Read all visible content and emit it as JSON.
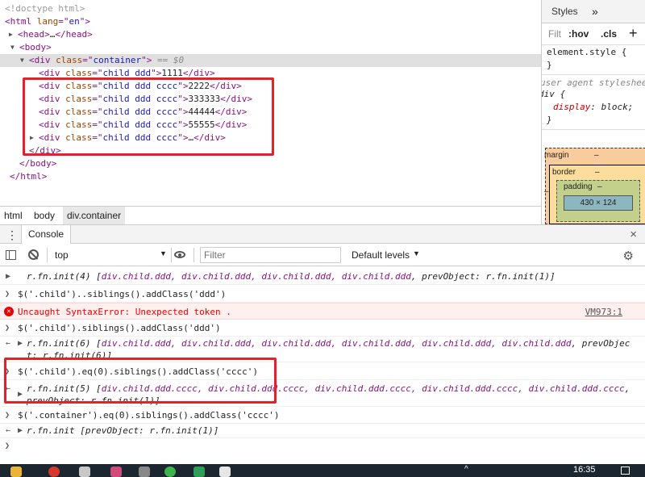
{
  "elements": {
    "lines": [
      {
        "indent": 0,
        "parts": [
          {
            "c": "comment",
            "t": "<!doctype html>"
          }
        ]
      },
      {
        "indent": 0,
        "parts": [
          {
            "c": "tag",
            "t": "<html "
          },
          {
            "c": "attr",
            "t": "lang"
          },
          {
            "c": "tag",
            "t": "=\""
          },
          {
            "c": "aval",
            "t": "en"
          },
          {
            "c": "tag",
            "t": "\">"
          }
        ]
      },
      {
        "indent": 1,
        "tri": "▶",
        "parts": [
          {
            "c": "tag",
            "t": "<head>"
          },
          {
            "c": "txt",
            "t": "…"
          },
          {
            "c": "tag",
            "t": "</head>"
          }
        ]
      },
      {
        "indent": 1,
        "tri": "▼",
        "parts": [
          {
            "c": "tag",
            "t": "<body>"
          }
        ]
      },
      {
        "indent": 2,
        "tri": "▼",
        "selected": true,
        "parts": [
          {
            "c": "tag",
            "t": "<div "
          },
          {
            "c": "attr",
            "t": "class"
          },
          {
            "c": "tag",
            "t": "=\""
          },
          {
            "c": "aval",
            "t": "container"
          },
          {
            "c": "tag",
            "t": "\">"
          },
          {
            "c": "txt",
            "t": " == $0"
          }
        ]
      },
      {
        "indent": 3,
        "parts": [
          {
            "c": "tag",
            "t": "<div "
          },
          {
            "c": "attr",
            "t": "class"
          },
          {
            "c": "tag",
            "t": "=\""
          },
          {
            "c": "aval",
            "t": "child ddd"
          },
          {
            "c": "tag",
            "t": "\">"
          },
          {
            "c": "txt",
            "t": "1111"
          },
          {
            "c": "tag",
            "t": "</div>"
          }
        ]
      },
      {
        "indent": 3,
        "parts": [
          {
            "c": "tag",
            "t": "<div "
          },
          {
            "c": "attr",
            "t": "class"
          },
          {
            "c": "tag",
            "t": "=\""
          },
          {
            "c": "aval",
            "t": "child ddd cccc"
          },
          {
            "c": "tag",
            "t": "\">"
          },
          {
            "c": "txt",
            "t": "2222"
          },
          {
            "c": "tag",
            "t": "</div>"
          }
        ]
      },
      {
        "indent": 3,
        "parts": [
          {
            "c": "tag",
            "t": "<div "
          },
          {
            "c": "attr",
            "t": "class"
          },
          {
            "c": "tag",
            "t": "=\""
          },
          {
            "c": "aval",
            "t": "child ddd cccc"
          },
          {
            "c": "tag",
            "t": "\">"
          },
          {
            "c": "txt",
            "t": "333333"
          },
          {
            "c": "tag",
            "t": "</div>"
          }
        ]
      },
      {
        "indent": 3,
        "parts": [
          {
            "c": "tag",
            "t": "<div "
          },
          {
            "c": "attr",
            "t": "class"
          },
          {
            "c": "tag",
            "t": "=\""
          },
          {
            "c": "aval",
            "t": "child ddd cccc"
          },
          {
            "c": "tag",
            "t": "\">"
          },
          {
            "c": "txt",
            "t": "44444"
          },
          {
            "c": "tag",
            "t": "</div>"
          }
        ]
      },
      {
        "indent": 3,
        "parts": [
          {
            "c": "tag",
            "t": "<div "
          },
          {
            "c": "attr",
            "t": "class"
          },
          {
            "c": "tag",
            "t": "=\""
          },
          {
            "c": "aval",
            "t": "child ddd cccc"
          },
          {
            "c": "tag",
            "t": "\">"
          },
          {
            "c": "txt",
            "t": "55555"
          },
          {
            "c": "tag",
            "t": "</div>"
          }
        ]
      },
      {
        "indent": 3,
        "tri": "▶",
        "parts": [
          {
            "c": "tag",
            "t": "<div "
          },
          {
            "c": "attr",
            "t": "class"
          },
          {
            "c": "tag",
            "t": "=\""
          },
          {
            "c": "aval",
            "t": "child ddd cccc"
          },
          {
            "c": "tag",
            "t": "\">"
          },
          {
            "c": "txt",
            "t": "…"
          },
          {
            "c": "tag",
            "t": "</div>"
          }
        ]
      },
      {
        "indent": 2,
        "parts": [
          {
            "c": "tag",
            "t": "</div>"
          }
        ]
      },
      {
        "indent": 1,
        "parts": [
          {
            "c": "tag",
            "t": "</body>"
          }
        ]
      },
      {
        "indent": 0,
        "parts": [
          {
            "c": "tag",
            "t": "</html>"
          }
        ]
      }
    ]
  },
  "styles": {
    "tab_label": "Styles",
    "more_tabs": "»",
    "filter_cut": "Filt",
    "hov": ":hov",
    "cls": ".cls",
    "add": "+",
    "element_style_selector": "element.style {",
    "close_brace": "}",
    "ua_comment": "user agent stylesheet",
    "ua_selector": "div {",
    "ua_prop": "display",
    "ua_value": "block;",
    "margin_label": "margin",
    "border_label": "border",
    "padding_label": "padding",
    "dash": "–",
    "content_size": "430 × 124"
  },
  "breadcrumb": [
    "html",
    "body",
    "div.container"
  ],
  "drawer": {
    "menu_icon": "⋮",
    "tab": "Console",
    "close": "×"
  },
  "console_toolbar": {
    "context": "top",
    "filter_placeholder": "Filter",
    "levels": "Default levels"
  },
  "console": {
    "m1_prefix": "r.fn.init(4) [",
    "m1_items": "div.child.ddd, div.child.ddd, div.child.ddd, div.child.ddd",
    "m1_suffix": ", prevObject: r.fn.init(1)]",
    "m2": "$('.child')..siblings().addClass('ddd')",
    "m3": "Uncaught SyntaxError: Unexpected token .",
    "m3_link": "VM973:1",
    "m4": "$('.child').siblings().addClass('ddd')",
    "m5_prefix": "r.fn.init(6) [",
    "m5_items": "div.child.ddd, div.child.ddd, div.child.ddd, div.child.ddd, div.child.ddd, div.child.ddd",
    "m5_suffix": ", prevObject: r.fn.init(6)]",
    "m6": "$('.child').eq(0).siblings().addClass('cccc')",
    "m7_prefix": "r.fn.init(5) [",
    "m7_items": "div.child.ddd.cccc, div.child.ddd.cccc, div.child.ddd.cccc, div.child.ddd.cccc, div.child.ddd.cccc",
    "m7_suffix": ", prevObject: r.fn.init(1)]",
    "m8": "$('.container').eq(0).siblings().addClass('cccc')",
    "m9": "r.fn.init [prevObject: r.fn.init(1)]"
  },
  "taskbar": {
    "time": "16:35"
  },
  "colors": {
    "highlight_box": "#e8202a",
    "error_bg": "#fff0f0",
    "selection": "#e0e0e0"
  }
}
